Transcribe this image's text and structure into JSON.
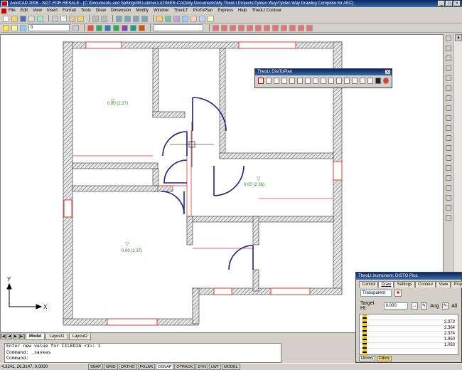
{
  "app": {
    "title": "AutoCAD 2006 - NOT FOR RESALE - [C:\\Documents and Settings\\M.Latimer.LATIMER-CAD\\My Documents\\My TheoLt Projects\\Tylden Way\\Tylden Way Drawing Complete for AEC]"
  },
  "menubar": {
    "items": [
      "File",
      "Edit",
      "View",
      "Insert",
      "Format",
      "Tools",
      "Draw",
      "Dimension",
      "Modify",
      "Window",
      "TheoLT",
      "ProToPlan",
      "Express",
      "Help",
      "TheoLt Contour"
    ]
  },
  "toolbar2": {
    "layer_value": "0"
  },
  "drawing": {
    "room_labels": [
      "0.00 (2.37)",
      "0.00 (2.36)",
      "0.00 (2.37)"
    ]
  },
  "floating_toolbar": {
    "title": "TheoLt DistToPlan",
    "close": "x"
  },
  "layout_tabs": [
    "Model",
    "Layout1",
    "Layout2"
  ],
  "command": {
    "lines": [
      "Enter new value for FILEDIA <1>: 1",
      "Command: _saveas",
      "Command:"
    ]
  },
  "status": {
    "coords": "4.3241, 26.3147, 0.0000",
    "buttons": [
      "SNAP",
      "GRID",
      "ORTHO",
      "POLAR",
      "OSNAP",
      "OTRACK",
      "DYN",
      "LWT",
      "MODEL"
    ]
  },
  "palette": {
    "title": "TheoLt Instrument: DISTO Plus",
    "tabs": [
      "Control",
      "Draw",
      "Settings",
      "Contour",
      "View",
      "Project"
    ],
    "mode": "Transparent",
    "target_label": "Target Ht:",
    "target_value": "0.000",
    "ang_label": "Ang",
    "all_label": "All",
    "values": [
      "2.373",
      "2.364",
      "2.374",
      "1.950",
      "1.083"
    ],
    "footer": [
      "History",
      "Filters"
    ]
  },
  "axis": {
    "x": "X",
    "y": "Y"
  },
  "colors": {
    "wall": "#808080",
    "door": "#1a237e",
    "measure": "#e53935",
    "room_label": "#2e7d32"
  }
}
